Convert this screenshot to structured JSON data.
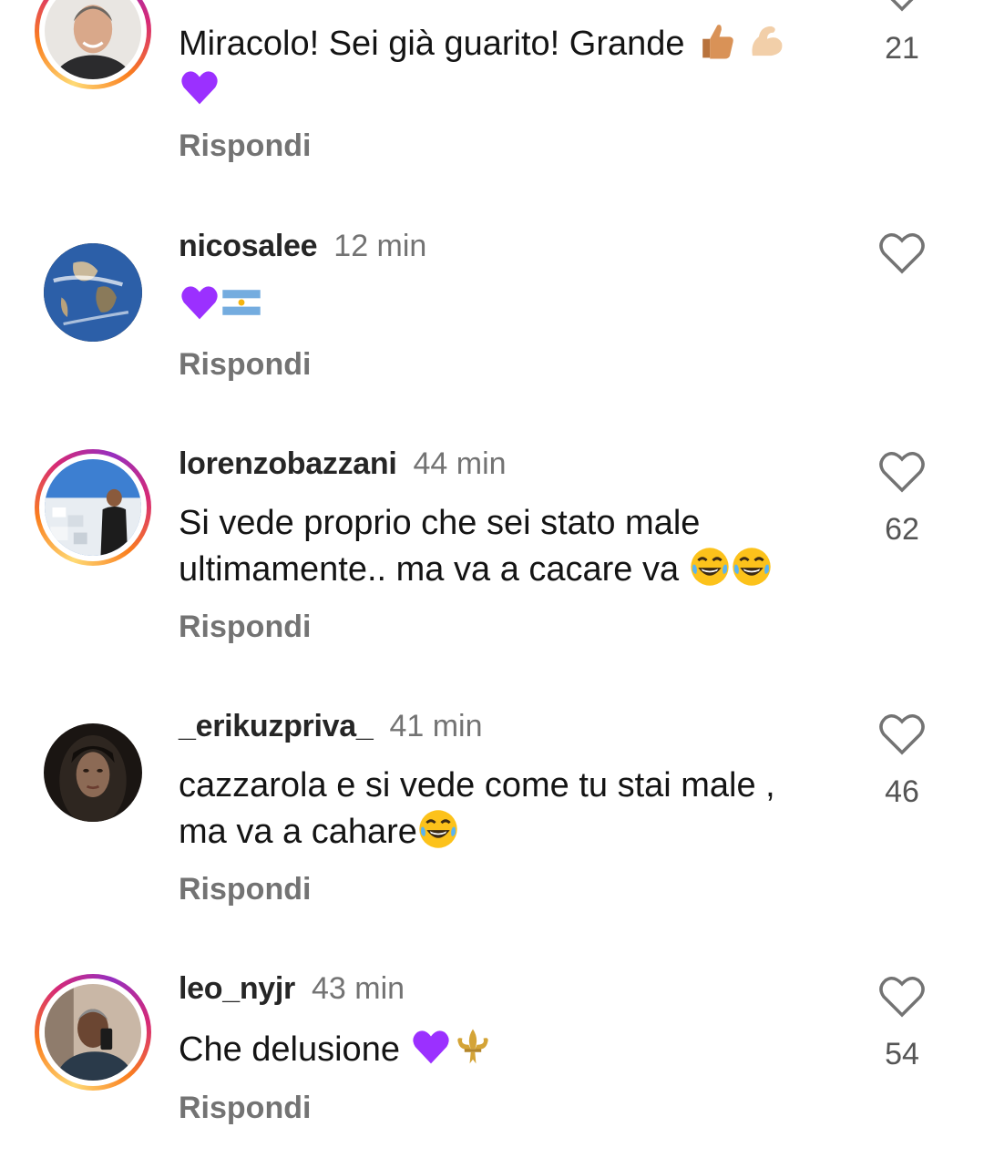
{
  "comments": [
    {
      "username": "",
      "time": "",
      "text": "Miracolo! Sei già guarito! Grande",
      "emojis": [
        "thumbs-up-emoji",
        "flexed-biceps-emoji",
        "purple-heart-emoji"
      ],
      "likes": "21",
      "reply_label": "Rispondi",
      "story_ring": true
    },
    {
      "username": "nicosalee",
      "time": "12 min",
      "text": "",
      "emojis": [
        "purple-heart-emoji",
        "argentina-flag-emoji"
      ],
      "likes": "",
      "reply_label": "Rispondi",
      "story_ring": false
    },
    {
      "username": "lorenzobazzani",
      "time": "44 min",
      "text_line1": "Si vede proprio che sei stato male",
      "text_line2": "ultimamente.. ma va a cacare va",
      "emojis": [
        "tears-of-joy-emoji",
        "tears-of-joy-emoji"
      ],
      "likes": "62",
      "reply_label": "Rispondi",
      "story_ring": true
    },
    {
      "username": "_erikuzpriva_",
      "time": "41 min",
      "text_line1": "cazzarola e si vede  come tu stai male ,",
      "text_line2": "ma va a cahare",
      "emojis": [
        "tears-of-joy-emoji"
      ],
      "likes": "46",
      "reply_label": "Rispondi",
      "story_ring": false
    },
    {
      "username": "leo_nyjr",
      "time": "43 min",
      "text": "Che delusione",
      "emojis": [
        "purple-heart-emoji",
        "fleur-de-lis-emoji"
      ],
      "likes": "54",
      "reply_label": "Rispondi",
      "story_ring": true
    }
  ],
  "colors": {
    "username": "#262626",
    "secondary_text": "#737373",
    "heart_outline": "#737373",
    "purple_heart": "#9b30ff",
    "story_ring": [
      "#feda75",
      "#fa7e1e",
      "#d62976",
      "#962fbf"
    ]
  }
}
